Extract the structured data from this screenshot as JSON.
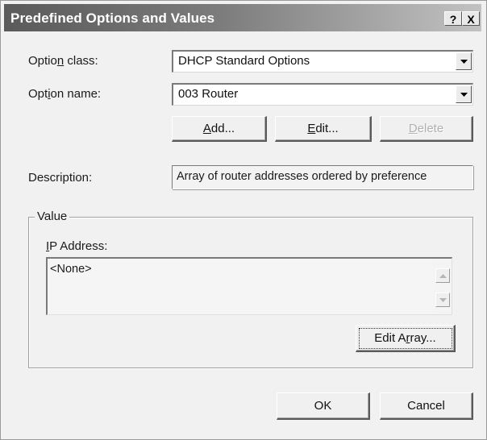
{
  "window": {
    "title": "Predefined Options and Values",
    "help_label": "?",
    "close_label": "X"
  },
  "option_class": {
    "label_before": "Optio",
    "label_accel": "n",
    "label_after": " class:",
    "value": "DHCP Standard Options"
  },
  "option_name": {
    "label_before": "Opt",
    "label_accel": "i",
    "label_after": "on name:",
    "value": "003 Router"
  },
  "actions": {
    "add_accel": "A",
    "add_rest": "dd...",
    "edit_accel": "E",
    "edit_rest": "dit...",
    "delete_accel": "D",
    "delete_rest": "elete"
  },
  "description": {
    "label": "Description:",
    "value": "Array of router addresses ordered by preference"
  },
  "value_group": {
    "legend": "Value",
    "ip_label_accel": "I",
    "ip_label_rest": "P Address:",
    "list_items": [
      "<None>"
    ],
    "edit_array_before": "Edit A",
    "edit_array_accel": "r",
    "edit_array_after": "ray..."
  },
  "footer": {
    "ok_label": "OK",
    "cancel_label": "Cancel"
  },
  "icons": {
    "combo_arrow": "chevron-down-icon",
    "scroll_up": "scroll-up-icon",
    "scroll_down": "scroll-down-icon"
  }
}
